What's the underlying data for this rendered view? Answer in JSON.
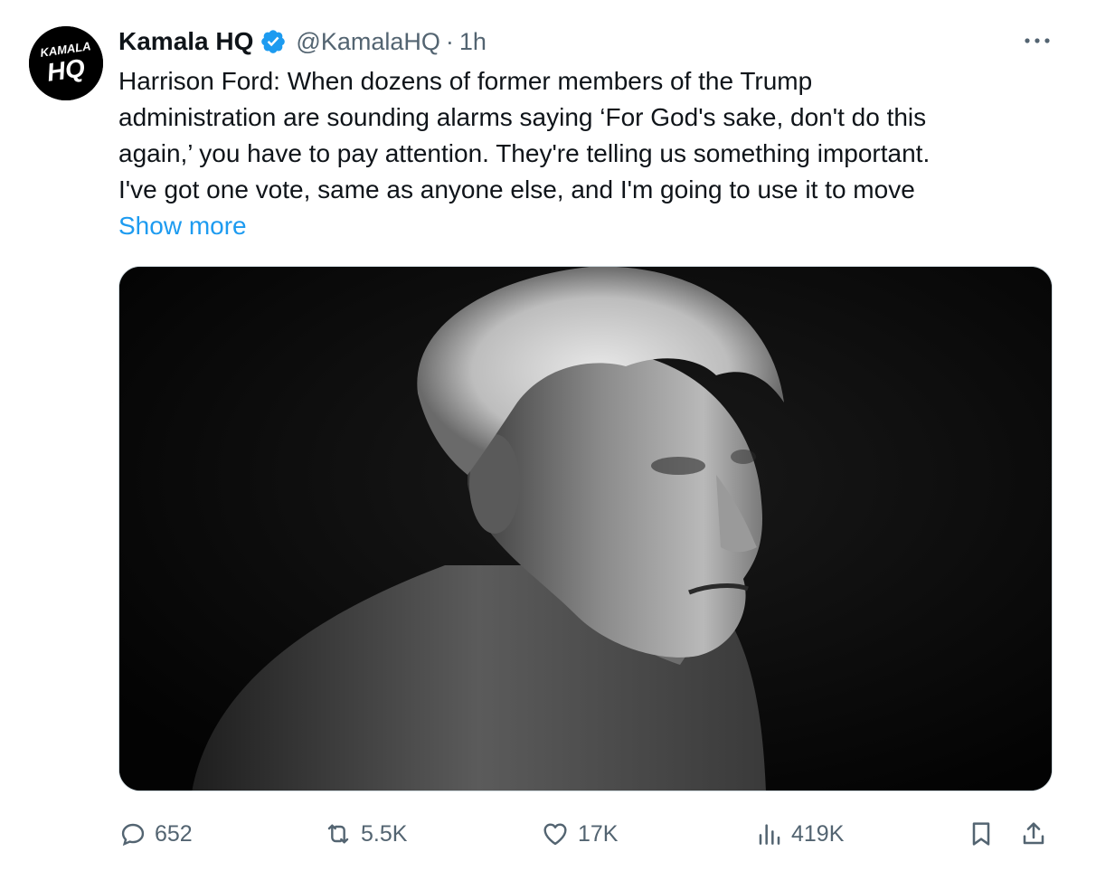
{
  "tweet": {
    "avatar": {
      "text_top": "KAMALA",
      "text_bottom": "HQ"
    },
    "author": {
      "display_name": "Kamala HQ",
      "verified_icon": "verified-badge-icon",
      "handle": "@KamalaHQ",
      "separator": "·",
      "time": "1h"
    },
    "more_icon": "more-horizontal-icon",
    "text_lines": [
      "Harrison Ford: When dozens of former members of the Trump",
      "administration are sounding alarms saying ‘For God's sake, don't do this",
      "again,’ you have to pay attention. They're telling us something important.",
      "I've got one vote, same as anyone else, and I'm going to use it to move"
    ],
    "show_more": "Show more",
    "actions": {
      "reply": {
        "icon": "reply-icon",
        "count": "652"
      },
      "retweet": {
        "icon": "retweet-icon",
        "count": "5.5K"
      },
      "like": {
        "icon": "heart-icon",
        "count": "17K"
      },
      "views": {
        "icon": "views-icon",
        "count": "419K"
      },
      "bookmark": {
        "icon": "bookmark-icon"
      },
      "share": {
        "icon": "share-icon"
      }
    }
  },
  "colors": {
    "text_primary": "#0f1419",
    "text_secondary": "#536471",
    "link": "#1d9bf0",
    "verified": "#1d9bf0",
    "media_background": "#050505"
  }
}
